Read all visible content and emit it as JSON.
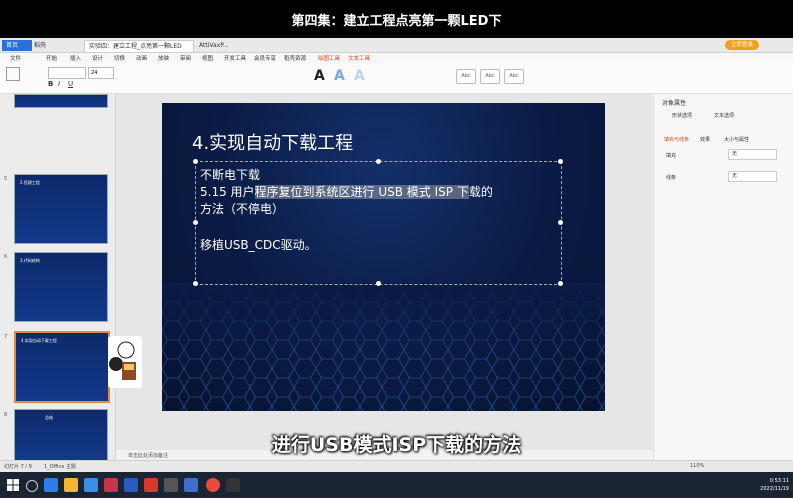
{
  "video_title": "第四集：建立工程点亮第一颗LED下",
  "subtitle": "进行USB模式ISP下载的方法",
  "tabs": [
    {
      "label": "首页"
    },
    {
      "label": "稻壳"
    },
    {
      "label": "实验四：建立工程_点亮第一颗LED"
    },
    {
      "label": "AttiVaxP..."
    }
  ],
  "login_button": "立即登录",
  "menus": [
    "文件",
    "开始",
    "插入",
    "设计",
    "切换",
    "动画",
    "放映",
    "审阅",
    "视图",
    "开发工具",
    "会员专享",
    "稻壳资源",
    "绘图工具",
    "文本工具"
  ],
  "ribbon": {
    "font_size": "24",
    "style_samples": [
      "Abc",
      "Abc",
      "Abc"
    ]
  },
  "thumbnails": [
    {
      "num": "4",
      "title": ""
    },
    {
      "num": "5",
      "title": "2.搭建工程"
    },
    {
      "num": "6",
      "title": "3.代码结构"
    },
    {
      "num": "7",
      "title": "4.实现自动下载工程"
    },
    {
      "num": "8",
      "title": "总结"
    }
  ],
  "slide": {
    "title": "4.实现自动下载工程",
    "lines": [
      "不断电下载",
      "5.15 用户",
      "程序复位到系统区进行 USB 模式 ISP 下",
      "载的",
      "方法（不停电）",
      "移植USB_CDC驱动。"
    ]
  },
  "right_panel": {
    "title": "对象属性",
    "tabs": [
      "形状选项",
      "文本选项"
    ],
    "subtabs": [
      "填充与线条",
      "效果",
      "大小与属性"
    ],
    "rows": [
      {
        "label": "填充",
        "value": "无"
      },
      {
        "label": "线条",
        "value": "无"
      }
    ]
  },
  "notes_placeholder": "单击此处添加备注",
  "status": {
    "slide_info": "幻灯片 7 / 9",
    "theme": "1_Office 主题",
    "zoom": "110%"
  },
  "clock": {
    "time": "0:53:11",
    "date": "2022/11/19"
  },
  "accent": "#2b6fd8"
}
